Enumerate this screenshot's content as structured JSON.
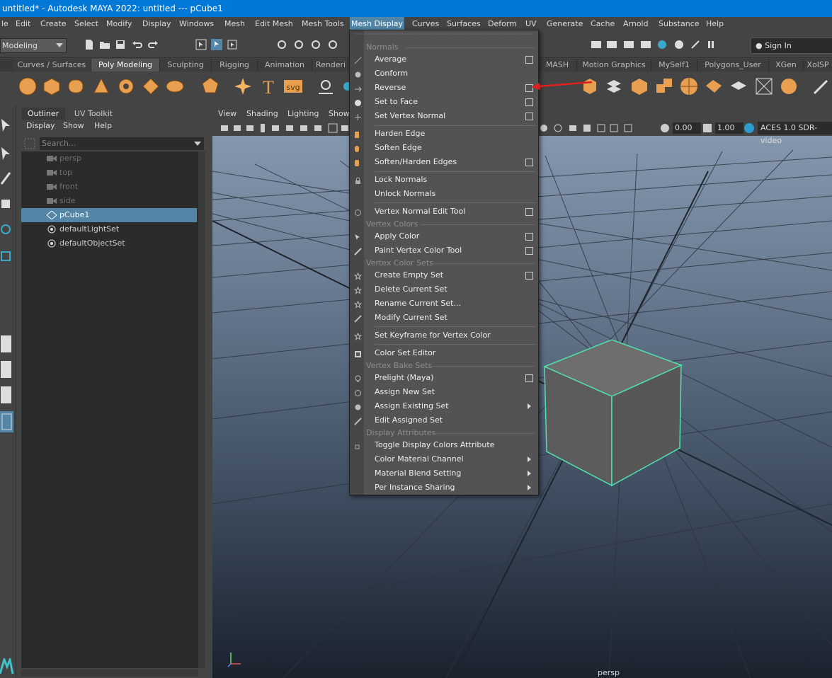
{
  "title": "untitled* - Autodesk MAYA 2022: untitled   ---   pCube1",
  "menubar": [
    "le",
    "Edit",
    "Create",
    "Select",
    "Modify",
    "Display",
    "Windows",
    "Mesh",
    "Edit Mesh",
    "Mesh Tools",
    "Mesh Display",
    "Curves",
    "Surfaces",
    "Deform",
    "UV",
    "Generate",
    "Cache",
    "Arnold",
    "Substance",
    "Help"
  ],
  "mode": "Modeling",
  "signin": "Sign In",
  "shelf_tabs": [
    "Curves / Surfaces",
    "Poly Modeling",
    "Sculpting",
    "Rigging",
    "Animation",
    "Renderi",
    "MASH",
    "Motion Graphics",
    "MySelf1",
    "Polygons_User",
    "XGen",
    "XoISP"
  ],
  "outliner": {
    "tabs": [
      "Outliner",
      "UV Toolkit"
    ],
    "menu": [
      "Display",
      "Show",
      "Help"
    ],
    "search_placeholder": "Search...",
    "items": [
      {
        "label": "persp"
      },
      {
        "label": "top"
      },
      {
        "label": "front"
      },
      {
        "label": "side"
      },
      {
        "label": "pCube1"
      },
      {
        "label": "defaultLightSet"
      },
      {
        "label": "defaultObjectSet"
      }
    ]
  },
  "viewport": {
    "menu": [
      "View",
      "Shading",
      "Lighting",
      "Show"
    ],
    "exposure": "0.00",
    "gamma": "1.00",
    "color_space": "ACES 1.0 SDR-video",
    "camera_label": "persp"
  },
  "dropdown": {
    "sections": [
      "Normals",
      "Vertex Colors",
      "Vertex Color Sets",
      "Vertex Bake Sets",
      "Display Attributes"
    ],
    "items": [
      {
        "label": "Average"
      },
      {
        "label": "Conform"
      },
      {
        "label": "Reverse"
      },
      {
        "label": "Set to Face"
      },
      {
        "label": "Set Vertex Normal"
      },
      {
        "label": "Harden Edge"
      },
      {
        "label": "Soften Edge"
      },
      {
        "label": "Soften/Harden Edges"
      },
      {
        "label": "Lock Normals"
      },
      {
        "label": "Unlock Normals"
      },
      {
        "label": "Vertex Normal Edit Tool"
      },
      {
        "label": "Apply Color"
      },
      {
        "label": "Paint Vertex Color Tool"
      },
      {
        "label": "Create Empty Set"
      },
      {
        "label": "Delete Current Set"
      },
      {
        "label": "Rename Current Set..."
      },
      {
        "label": "Modify Current Set"
      },
      {
        "label": "Set Keyframe for Vertex Color"
      },
      {
        "label": "Color Set Editor"
      },
      {
        "label": "Prelight (Maya)"
      },
      {
        "label": "Assign New Set"
      },
      {
        "label": "Assign Existing Set"
      },
      {
        "label": "Edit Assigned Set"
      },
      {
        "label": "Toggle Display Colors Attribute"
      },
      {
        "label": "Color Material Channel"
      },
      {
        "label": "Material Blend Setting"
      },
      {
        "label": "Per Instance Sharing"
      }
    ]
  },
  "colors": {
    "accent": "#5285a6",
    "title_bar": "#0078d7",
    "shelf_orange": "#e8a050",
    "selection_green": "#4fe3b0"
  }
}
